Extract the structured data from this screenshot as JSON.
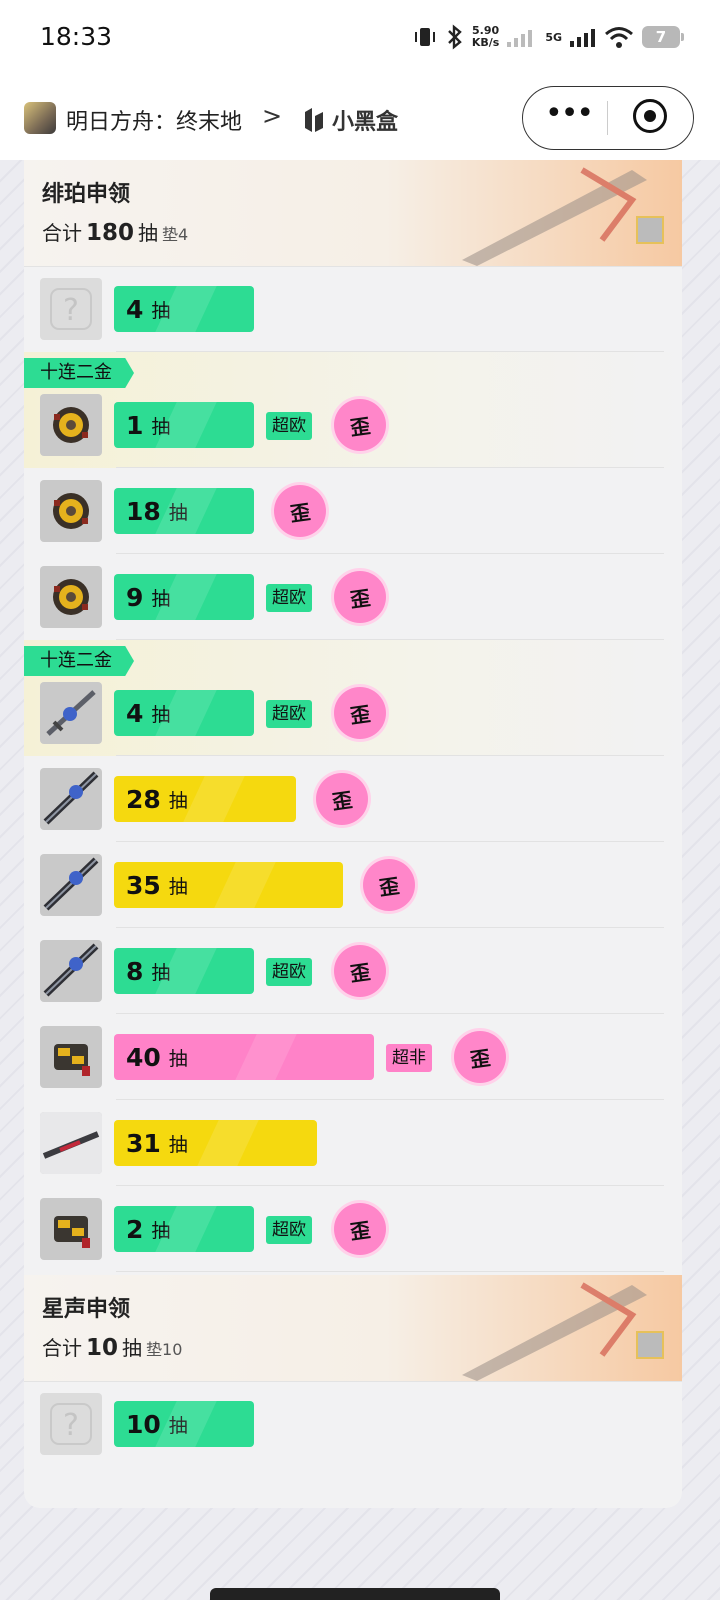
{
  "status": {
    "time": "18:33",
    "speed_value": "5.90",
    "speed_unit": "KB/s",
    "network": "5G",
    "battery": "7"
  },
  "nav": {
    "app_title": "明日方舟：终末地",
    "chevron": ">",
    "brand": "小黑盒"
  },
  "banners": [
    {
      "name": "绯珀申领",
      "total_prefix": "合计",
      "total": "180",
      "total_unit": "抽",
      "pad": "垫4",
      "rows": [
        {
          "icon": "unknown-item-icon",
          "pulls": "4",
          "unit": "抽",
          "color": "green",
          "level": 0.09,
          "tag": "",
          "wai": false,
          "highlight": false,
          "ribbon": ""
        },
        {
          "icon": "gold-relic-icon",
          "pulls": "1",
          "unit": "抽",
          "color": "green",
          "level": 0.09,
          "tag": "超欧",
          "wai": true,
          "highlight": true,
          "ribbon": "十连二金"
        },
        {
          "icon": "gold-relic-icon",
          "pulls": "18",
          "unit": "抽",
          "color": "green",
          "level": 0.22,
          "tag": "",
          "wai": true,
          "highlight": false,
          "ribbon": ""
        },
        {
          "icon": "gold-relic-icon",
          "pulls": "9",
          "unit": "抽",
          "color": "green",
          "level": 0.11,
          "tag": "超欧",
          "wai": true,
          "highlight": false,
          "ribbon": ""
        },
        {
          "icon": "blue-blade-icon",
          "pulls": "4",
          "unit": "抽",
          "color": "green",
          "level": 0.09,
          "tag": "超欧",
          "wai": true,
          "highlight": true,
          "ribbon": "十连二金"
        },
        {
          "icon": "blue-sword-icon",
          "pulls": "28",
          "unit": "抽",
          "color": "yellow",
          "level": 0.35,
          "tag": "",
          "wai": true,
          "highlight": false,
          "ribbon": ""
        },
        {
          "icon": "blue-sword-icon",
          "pulls": "35",
          "unit": "抽",
          "color": "yellow",
          "level": 0.44,
          "tag": "",
          "wai": true,
          "highlight": false,
          "ribbon": ""
        },
        {
          "icon": "blue-sword-icon",
          "pulls": "8",
          "unit": "抽",
          "color": "green",
          "level": 0.1,
          "tag": "超欧",
          "wai": true,
          "highlight": false,
          "ribbon": ""
        },
        {
          "icon": "gold-gauntlet-icon",
          "pulls": "40",
          "unit": "抽",
          "color": "pink",
          "level": 0.5,
          "tag": "超非",
          "wai": true,
          "highlight": false,
          "ribbon": ""
        },
        {
          "icon": "crimson-blade-icon",
          "pulls": "31",
          "unit": "抽",
          "color": "yellow",
          "level": 0.39,
          "tag": "",
          "wai": false,
          "highlight": false,
          "ribbon": ""
        },
        {
          "icon": "gold-gauntlet-icon",
          "pulls": "2",
          "unit": "抽",
          "color": "green",
          "level": 0.09,
          "tag": "超欧",
          "wai": true,
          "highlight": false,
          "ribbon": ""
        }
      ]
    },
    {
      "name": "星声申领",
      "total_prefix": "合计",
      "total": "10",
      "total_unit": "抽",
      "pad": "垫10",
      "rows": [
        {
          "icon": "unknown-item-icon",
          "pulls": "10",
          "unit": "抽",
          "color": "green",
          "level": 0.12,
          "tag": "",
          "wai": false,
          "highlight": false,
          "ribbon": ""
        }
      ]
    }
  ],
  "wai_label": "歪",
  "colors": {
    "green": "#2ddc93",
    "yellow": "#f5d90f",
    "pink": "#ff82c8"
  }
}
